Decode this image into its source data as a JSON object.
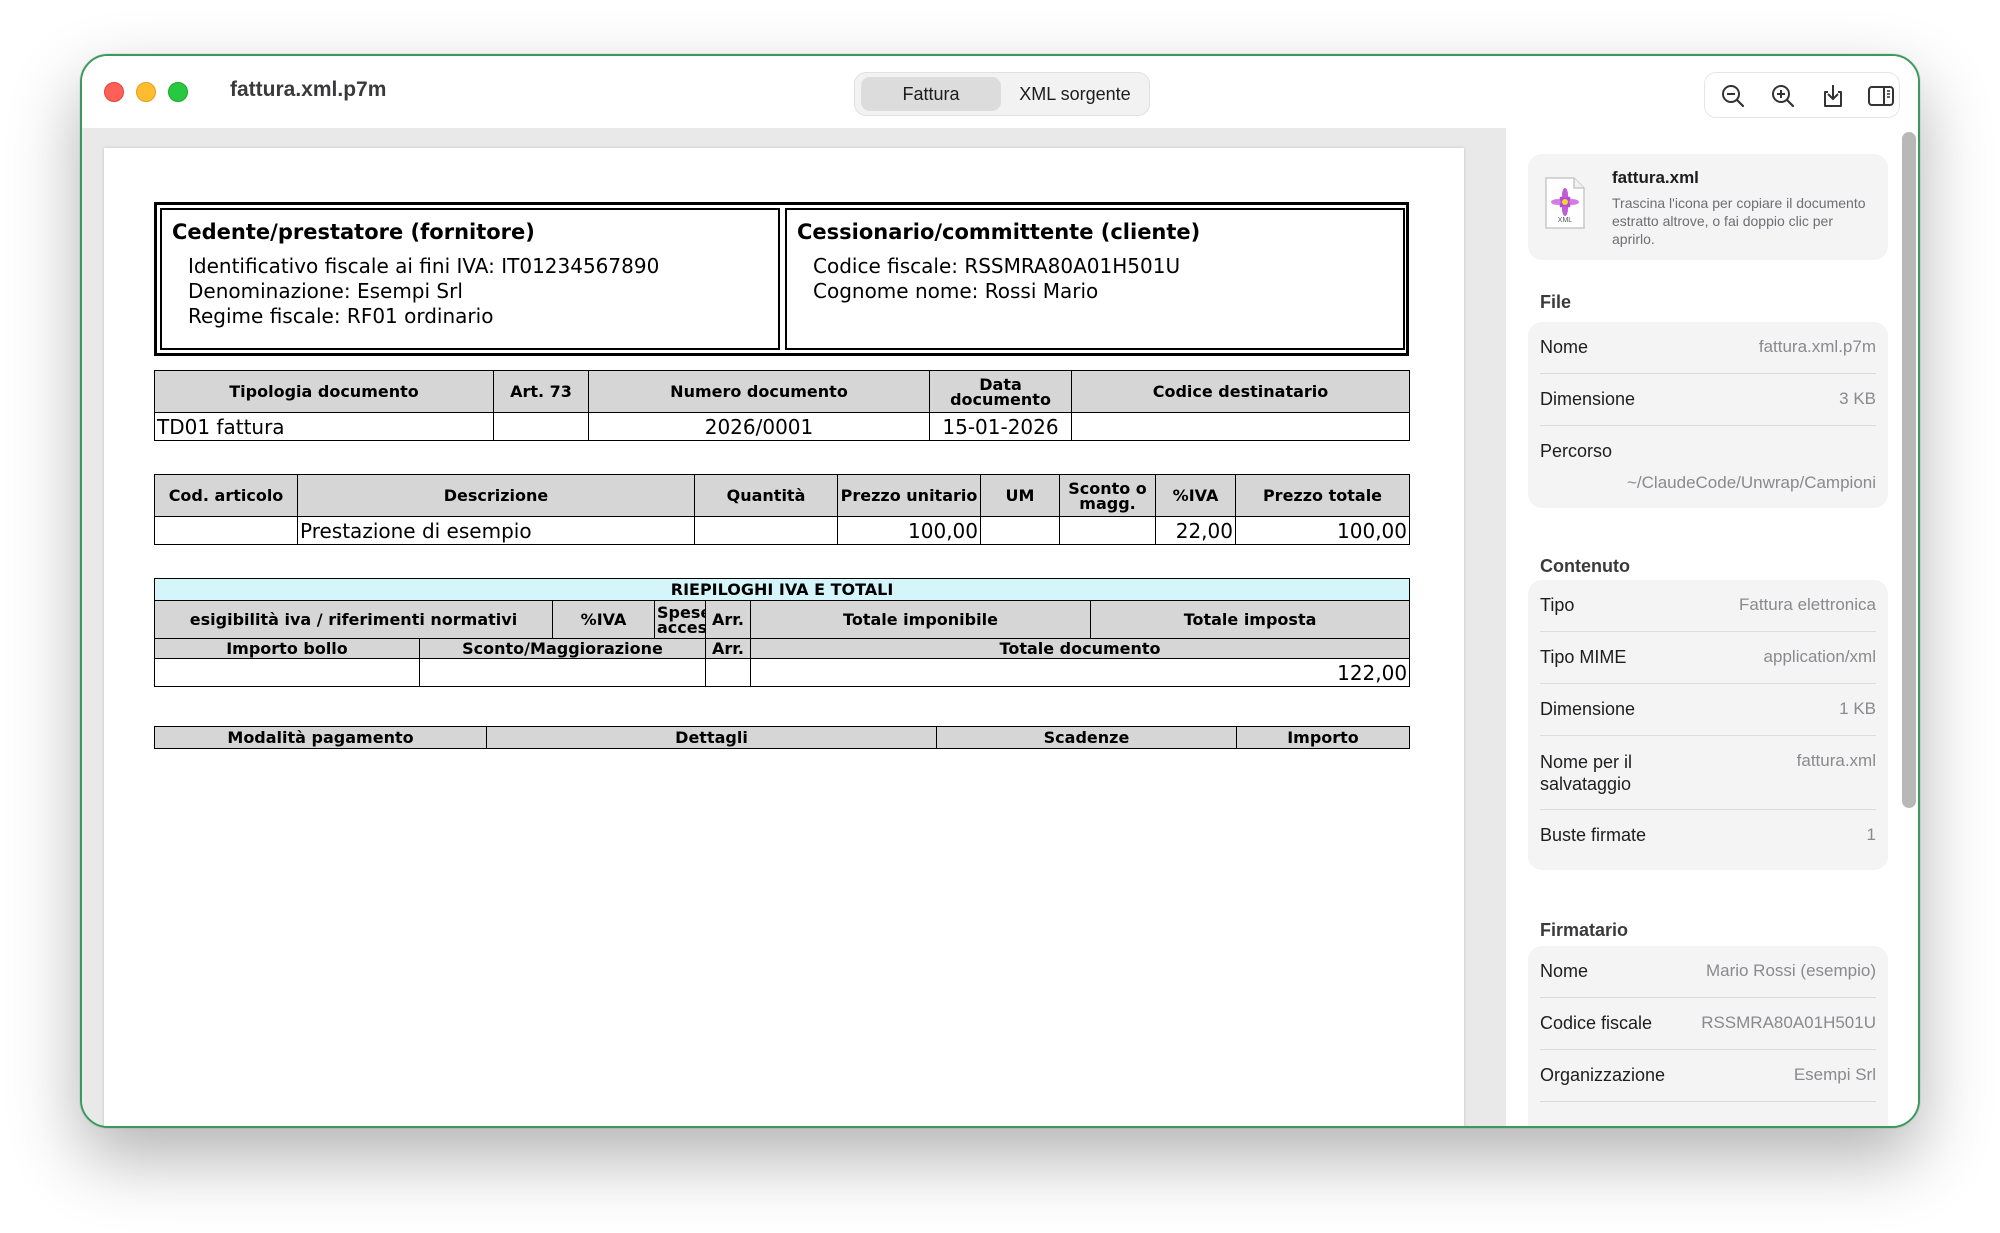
{
  "window": {
    "title": "fattura.xml.p7m",
    "tabs": [
      {
        "label": "Fattura"
      },
      {
        "label": "XML sorgente"
      }
    ],
    "accent": "#3a9a5c"
  },
  "toolbar": {
    "icons": [
      "zoom-out-icon",
      "zoom-in-icon",
      "export-icon",
      "sidebar-toggle-icon"
    ]
  },
  "invoice": {
    "cedente": {
      "title": "Cedente/prestatore (fornitore)",
      "lines": [
        "Identificativo fiscale ai fini IVA: IT01234567890",
        "Denominazione: Esempi Srl",
        "Regime fiscale: RF01 ordinario"
      ]
    },
    "cessionario": {
      "title": "Cessionario/committente (cliente)",
      "lines": [
        "Codice fiscale: RSSMRA80A01H501U",
        "Cognome nome: Rossi Mario"
      ]
    },
    "doc_table": {
      "headers": [
        "Tipologia documento",
        "Art. 73",
        "Numero documento",
        "Data documento",
        "Codice destinatario"
      ],
      "row": [
        "TD01 fattura",
        "",
        "2026/0001",
        "15-01-2026",
        ""
      ]
    },
    "lines_table": {
      "headers": [
        "Cod. articolo",
        "Descrizione",
        "Quantità",
        "Prezzo unitario",
        "UM",
        "Sconto o magg.",
        "%IVA",
        "Prezzo totale"
      ],
      "row": [
        "",
        "Prestazione di esempio",
        "",
        "100,00",
        "",
        "",
        "22,00",
        "100,00"
      ]
    },
    "summary_table": {
      "title": "RIEPILOGHI IVA E TOTALI",
      "headers1": [
        "esigibilità iva / riferimenti normativi",
        "%IVA",
        "Spese accessorie",
        "Arr.",
        "Totale imponibile",
        "Totale imposta"
      ],
      "headers2": [
        "Importo bollo",
        "Sconto/Maggiorazione",
        "Arr.",
        "Totale documento"
      ],
      "row": [
        "",
        "",
        "",
        "122,00"
      ]
    },
    "payment_table": {
      "headers": [
        "Modalità pagamento",
        "Dettagli",
        "Scadenze",
        "Importo"
      ]
    }
  },
  "sidebar": {
    "file_card": {
      "name": "fattura.xml",
      "hint": "Trascina l'icona per copiare il documento estratto altrove, o fai doppio clic per aprirlo.",
      "icon_label": "XML"
    },
    "sections": [
      {
        "title": "File",
        "rows": [
          {
            "key": "Nome",
            "value": "fattura.xml.p7m"
          },
          {
            "key": "Dimensione",
            "value": "3 KB"
          },
          {
            "key": "Percorso",
            "value": "~/ClaudeCode/Unwrap/Campioni"
          }
        ]
      },
      {
        "title": "Contenuto",
        "rows": [
          {
            "key": "Tipo",
            "value": "Fattura elettronica"
          },
          {
            "key": "Tipo MIME",
            "value": "application/xml"
          },
          {
            "key": "Dimensione",
            "value": "1 KB"
          },
          {
            "key": "Nome per il salvataggio",
            "value": "fattura.xml"
          },
          {
            "key": "Buste firmate",
            "value": "1"
          }
        ]
      },
      {
        "title": "Firmatario",
        "rows": [
          {
            "key": "Nome",
            "value": "Mario Rossi (esempio)"
          },
          {
            "key": "Codice fiscale",
            "value": "RSSMRA80A01H501U"
          },
          {
            "key": "Organizzazione",
            "value": "Esempi Srl"
          }
        ]
      }
    ]
  }
}
